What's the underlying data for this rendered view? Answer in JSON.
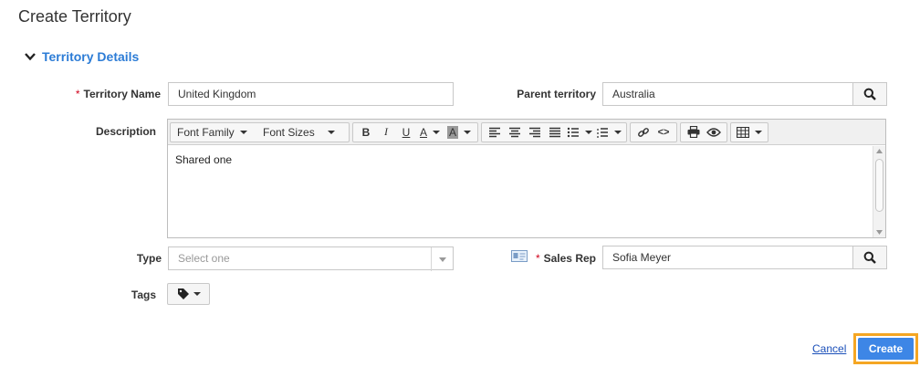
{
  "page_title": "Create Territory",
  "section": {
    "title": "Territory Details"
  },
  "fields": {
    "territory_name": {
      "label": "Territory Name",
      "required_marker": "*",
      "value": "United Kingdom"
    },
    "parent_territory": {
      "label": "Parent territory",
      "value": "Australia"
    },
    "description": {
      "label": "Description",
      "content": "Shared one",
      "toolbar": {
        "font_family": "Font Family",
        "font_sizes": "Font Sizes",
        "bold": "B",
        "italic": "I",
        "underline": "U",
        "font_color": "A",
        "bg_color": "A",
        "code": "<>"
      }
    },
    "type": {
      "label": "Type",
      "placeholder": "Select one"
    },
    "sales_rep": {
      "label": "Sales Rep",
      "required_marker": "*",
      "value": "Sofia Meyer"
    },
    "tags": {
      "label": "Tags"
    }
  },
  "actions": {
    "cancel": "Cancel",
    "create": "Create"
  },
  "colors": {
    "accent": "#2c7cd6",
    "primary_button": "#3d86e6",
    "focus_ring": "#f5a623",
    "required": "#d0021b"
  }
}
